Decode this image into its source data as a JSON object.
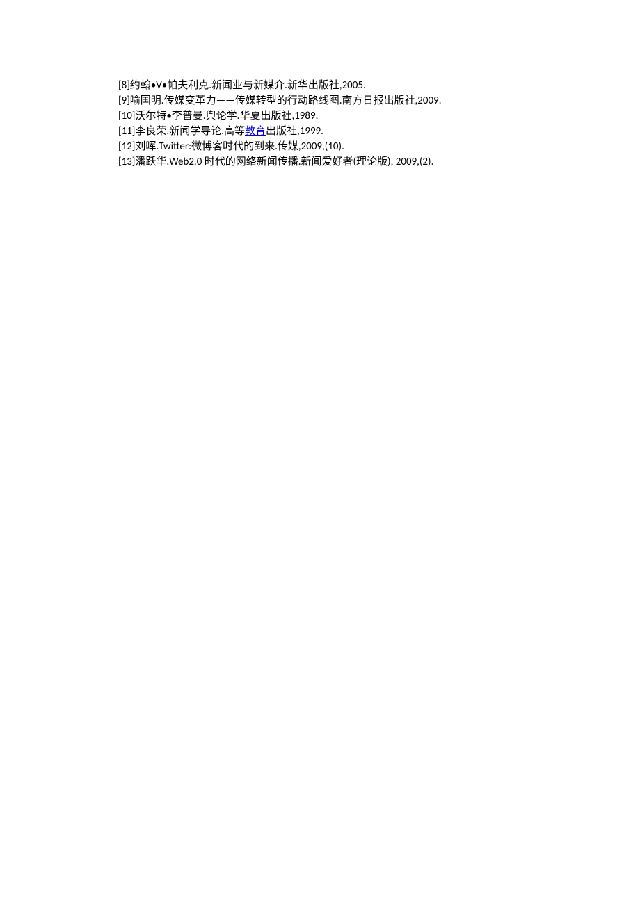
{
  "references": [
    {
      "prefix": "[8]约翰•V•帕夫利克.新闻业与新媒介.新华出版社,2005.",
      "link": "",
      "suffix": ""
    },
    {
      "prefix": "[9]喻国明.传媒变革力——传媒转型的行动路线图.南方日报出版社,2009.",
      "link": "",
      "suffix": ""
    },
    {
      "prefix": "[10]沃尔特•李普曼.舆论学.华夏出版社,1989.",
      "link": "",
      "suffix": ""
    },
    {
      "prefix": "[11]李良荣.新闻学导论.高等",
      "link": "教育",
      "suffix": "出版社,1999."
    },
    {
      "prefix": "[12]刘晖.Twitter:微博客时代的到来.传媒,2009,(10).",
      "link": "",
      "suffix": ""
    },
    {
      "prefix": "[13]潘跃华.Web2.0 时代的网络新闻传播.新闻爱好者(理论版), 2009,(2).",
      "link": "",
      "suffix": ""
    }
  ]
}
